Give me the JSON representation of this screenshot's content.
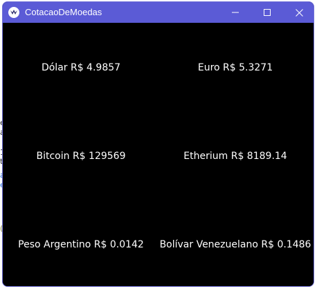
{
  "window": {
    "title": "CotacaoDeMoedas",
    "colors": {
      "titlebar": "#5b5bd6",
      "border": "#6f6fd8",
      "background": "#000000",
      "text": "#ffffff"
    },
    "controls": {
      "minimize_icon": "minimize-icon",
      "maximize_icon": "maximize-icon",
      "close_icon": "close-icon"
    }
  },
  "rates": [
    {
      "label": "Dólar R$ 4.9857"
    },
    {
      "label": "Euro R$ 5.3271"
    },
    {
      "label": "Bitcoin R$ 129569"
    },
    {
      "label": "Etherium R$ 8189.14"
    },
    {
      "label": "Peso Argentino R$ 0.0142"
    },
    {
      "label": "Bolívar Venezuelano R$ 0.1486"
    }
  ]
}
